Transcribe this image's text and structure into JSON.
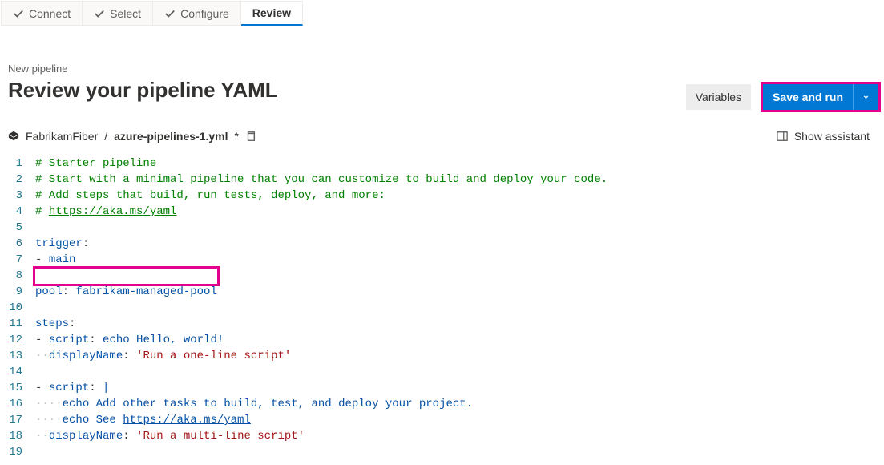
{
  "wizard": {
    "steps": [
      {
        "label": "Connect",
        "done": true
      },
      {
        "label": "Select",
        "done": true
      },
      {
        "label": "Configure",
        "done": true
      },
      {
        "label": "Review",
        "active": true
      }
    ]
  },
  "header": {
    "breadcrumb": "New pipeline",
    "title": "Review your pipeline YAML",
    "variables_label": "Variables",
    "save_run_label": "Save and run"
  },
  "path": {
    "repo": "FabrikamFiber",
    "sep": "/",
    "file": "azure-pipelines-1.yml",
    "dirty": "*"
  },
  "assistant_label": "Show assistant",
  "code": {
    "n1": "1",
    "l1": "# Starter pipeline",
    "n2": "2",
    "l2": "# Start with a minimal pipeline that you can customize to build and deploy your code.",
    "n3": "3",
    "l3": "# Add steps that build, run tests, deploy, and more:",
    "n4": "4",
    "l4a": "# ",
    "l4b": "https://aka.ms/yaml",
    "n5": "5",
    "n6": "6",
    "l6a": "trigger",
    "l6b": ":",
    "n7": "7",
    "l7a": "- ",
    "l7b": "main",
    "n8": "8",
    "n9": "9",
    "l9a": "pool",
    "l9b": ": ",
    "l9c": "fabrikam-managed-pool",
    "n10": "10",
    "n11": "11",
    "l11a": "steps",
    "l11b": ":",
    "n12": "12",
    "l12a": "- ",
    "l12b": "script",
    "l12c": ": ",
    "l12d": "echo Hello, world!",
    "n13": "13",
    "ind": "··",
    "l13a": "displayName",
    "l13b": ": ",
    "l13c": "'Run a one-line script'",
    "n14": "14",
    "n15": "15",
    "l15a": "- ",
    "l15b": "script",
    "l15c": ": ",
    "l15d": "|",
    "n16": "16",
    "ind4": "····",
    "l16": "echo Add other tasks to build, test, and deploy your project.",
    "n17": "17",
    "l17a": "echo See ",
    "l17b": "https://aka.ms/yaml",
    "n18": "18",
    "l18a": "displayName",
    "l18b": ": ",
    "l18c": "'Run a multi-line script'",
    "n19": "19"
  }
}
